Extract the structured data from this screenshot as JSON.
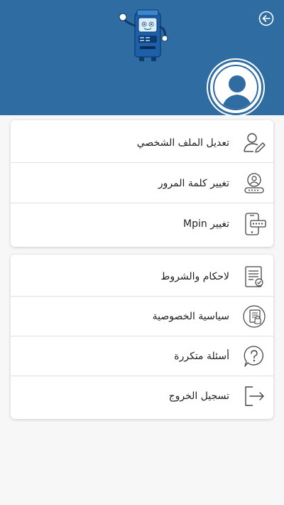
{
  "header": {
    "background_color": "#2e6ca2",
    "back_icon": "back-arrow-icon",
    "mascot_icon": "atm-mascot",
    "avatar_icon": "user-avatar-icon"
  },
  "account_menu": {
    "items": [
      {
        "label": "تعديل الملف الشخصي",
        "icon": "user-edit-icon"
      },
      {
        "label": "تغيير كلمة المرور",
        "icon": "password-user-icon"
      },
      {
        "label": "تغيير Mpin",
        "icon": "mobile-pin-icon"
      }
    ]
  },
  "info_menu": {
    "items": [
      {
        "label": "لاحكام والشروط",
        "icon": "terms-document-icon"
      },
      {
        "label": "سياسية الخصوصية",
        "icon": "privacy-policy-icon"
      },
      {
        "label": "أسئلة متكررة",
        "icon": "faq-question-icon"
      },
      {
        "label": "تسجيل الخروج",
        "icon": "logout-icon"
      }
    ]
  }
}
